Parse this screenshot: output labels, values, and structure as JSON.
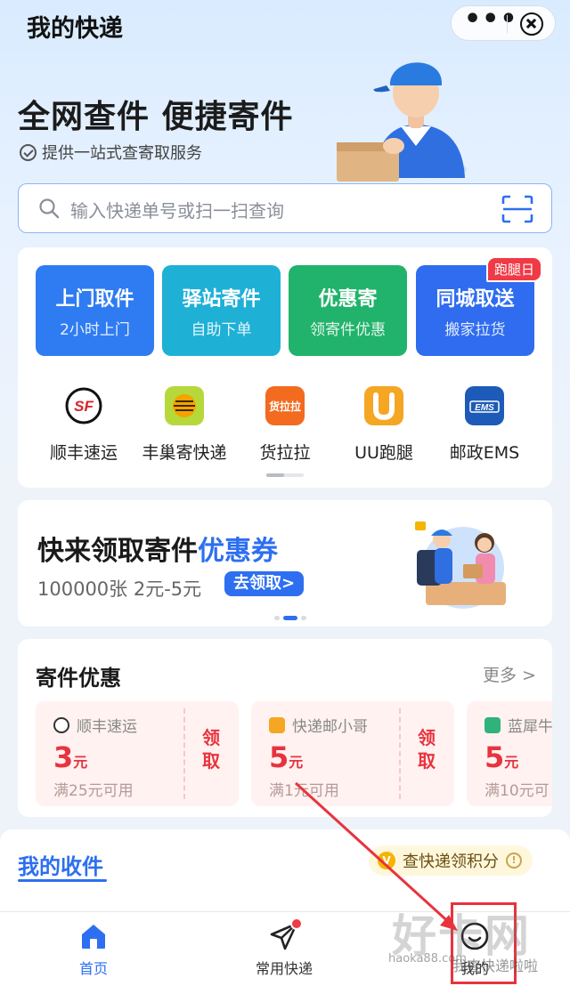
{
  "header": {
    "title": "我的快递",
    "more_label": "•••"
  },
  "hero": {
    "title": "全网查件 便捷寄件",
    "subtitle": "提供一站式查寄取服务"
  },
  "search": {
    "placeholder": "输入快递单号或扫一扫查询"
  },
  "services": [
    {
      "title": "上门取件",
      "sub": "2小时上门",
      "color": "#2f7cf2"
    },
    {
      "title": "驿站寄件",
      "sub": "自助下单",
      "color": "#1fb0d6"
    },
    {
      "title": "优惠寄",
      "sub": "领寄件优惠",
      "color": "#21b36b"
    },
    {
      "title": "同城取送",
      "sub": "搬家拉货",
      "color": "#2f6cf0",
      "badge": "跑腿日"
    }
  ],
  "carriers": [
    {
      "name": "顺丰速运",
      "icon": "sf-express-icon"
    },
    {
      "name": "丰巢寄快递",
      "icon": "hive-box-icon"
    },
    {
      "name": "货拉拉",
      "icon": "lalamove-icon",
      "logo_text": "货拉拉"
    },
    {
      "name": "UU跑腿",
      "icon": "uu-paotui-icon"
    },
    {
      "name": "邮政EMS",
      "icon": "ems-icon",
      "logo_text": "EMS"
    }
  ],
  "promo": {
    "title_part1": "快来领取寄件",
    "title_highlight": "优惠券",
    "sub": "100000张 2元-5元",
    "button": "去领取>"
  },
  "deals": {
    "title": "寄件优惠",
    "more": "更多 >",
    "get_label": "领取",
    "coupons": [
      {
        "brand": "顺丰速运",
        "amount": "3",
        "unit": "元",
        "cond": "满25元可用"
      },
      {
        "brand": "快递邮小哥",
        "amount": "5",
        "unit": "元",
        "cond": "满1元可用"
      },
      {
        "brand": "蓝犀牛",
        "amount": "5",
        "unit": "元",
        "cond": "满10元可"
      }
    ]
  },
  "receive": {
    "title": "我的收件",
    "points": "查快递领积分",
    "points_info": "!"
  },
  "tabbar": [
    {
      "label": "首页",
      "active": true
    },
    {
      "label": "常用快递",
      "active": false
    },
    {
      "label": "我的",
      "active": false
    }
  ],
  "watermark": {
    "big": "好卡网",
    "small": "haoka88.com",
    "right": "我查快递啦啦"
  },
  "colors": {
    "accent": "#2d6ff0",
    "coupon_red": "#e8333e",
    "annotation_red": "#e8333e"
  }
}
